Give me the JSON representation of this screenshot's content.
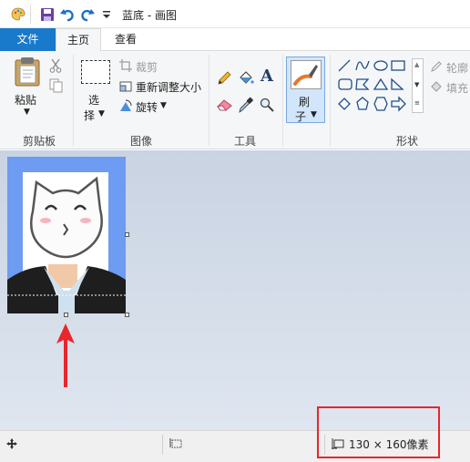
{
  "window": {
    "title": "蓝底 - 画图"
  },
  "tabs": [
    {
      "label": "文件"
    },
    {
      "label": "主页"
    },
    {
      "label": "查看"
    }
  ],
  "ribbon": {
    "clipboard": {
      "paste": "粘贴",
      "group": "剪贴板"
    },
    "image": {
      "select_1": "选",
      "select_2": "择",
      "crop": "裁剪",
      "resize": "重新调整大小",
      "rotate": "旋转",
      "group": "图像"
    },
    "tools": {
      "text_icon": "A",
      "group": "工具"
    },
    "brushes": {
      "label_1": "刷",
      "label_2": "子"
    },
    "shapes": {
      "outline": "轮廓",
      "fill": "填充",
      "group": "形状"
    }
  },
  "status": {
    "image_size": "130 × 160像素"
  },
  "colors": {
    "file_tab": "#1979ca",
    "canvas_bg": "#6d9cf2",
    "annotation": "#e8262c"
  },
  "icons": [
    "paint-app-icon",
    "save-icon",
    "undo-icon",
    "redo-icon",
    "customize-dropdown-icon",
    "paste-icon",
    "cut-icon",
    "copy-icon",
    "select-icon",
    "crop-icon",
    "resize-icon",
    "rotate-icon",
    "pencil-icon",
    "fill-bucket-icon",
    "text-icon",
    "eraser-icon",
    "color-picker-icon",
    "magnifier-icon",
    "brush-icon",
    "move-cursor-icon",
    "selection-size-icon",
    "image-size-icon"
  ]
}
